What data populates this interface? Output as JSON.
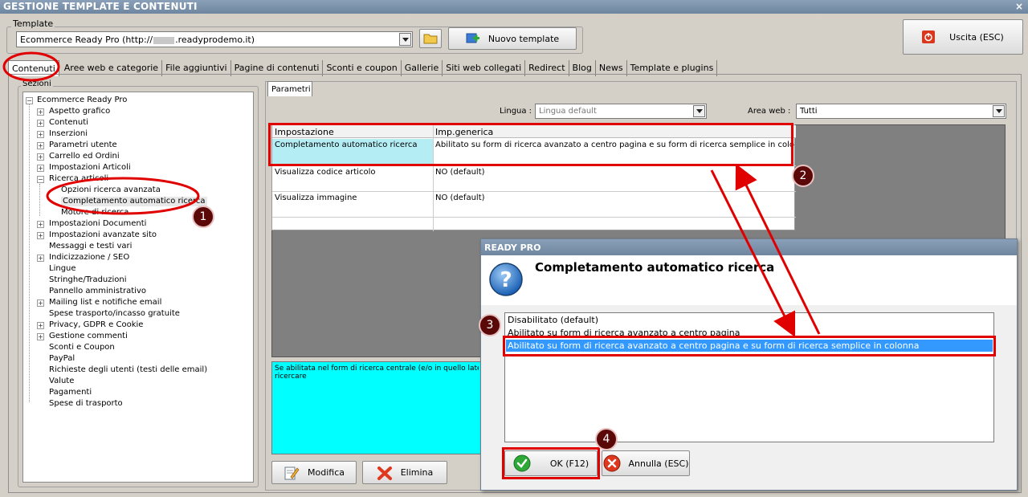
{
  "window": {
    "title": "GESTIONE TEMPLATE E CONTENUTI",
    "close_glyph": "×"
  },
  "template": {
    "group_label": "Template",
    "selected": "Ecommerce Ready Pro (http://",
    "selected_suffix": ".readyprodemo.it)",
    "new_template_label": "Nuovo template"
  },
  "exit_button": {
    "label": "Uscita (ESC)"
  },
  "tabs": [
    {
      "label": "Contenuti",
      "active": true
    },
    {
      "label": "Aree web e categorie"
    },
    {
      "label": "File aggiuntivi"
    },
    {
      "label": "Pagine di contenuti"
    },
    {
      "label": "Sconti e coupon"
    },
    {
      "label": "Gallerie"
    },
    {
      "label": "Siti web collegati"
    },
    {
      "label": "Redirect"
    },
    {
      "label": "Blog"
    },
    {
      "label": "News"
    },
    {
      "label": "Template e plugins"
    }
  ],
  "sections": {
    "label": "Sezioni",
    "root": "Ecommerce Ready Pro",
    "items": [
      "Aspetto grafico",
      "Contenuti",
      "Inserzioni",
      "Parametri utente",
      "Carrello ed Ordini",
      "Impostazioni Articoli",
      "Ricerca articoli",
      "Opzioni ricerca avanzata",
      "Completamento automatico ricerca",
      "Motore di ricerca",
      "Impostazioni Documenti",
      "Impostazioni avanzate sito",
      "Messaggi e testi vari",
      "Indicizzazione / SEO",
      "Lingue",
      "Stringhe/Traduzioni",
      "Pannello amministrativo",
      "Mailing list e notifiche email",
      "Spese trasporto/incasso gratuite",
      "Privacy, GDPR e Cookie",
      "Gestione commenti",
      "Sconti e Coupon",
      "PayPal",
      "Richieste degli utenti (testi delle email)",
      "Valute",
      "Pagamenti",
      "Spese di trasporto"
    ]
  },
  "params": {
    "tab_label": "Parametri",
    "lingua_label": "Lingua :",
    "lingua_value": "Lingua default",
    "area_label": "Area web :",
    "area_value": "Tutti",
    "columns": [
      "Impostazione",
      "Imp.generica"
    ],
    "rows": [
      {
        "name": "Completamento automatico ricerca",
        "value": "Abilitato su form di ricerca avanzato a centro pagina e su form di ricerca semplice in colonna"
      },
      {
        "name": "Visualizza codice articolo",
        "value": "NO (default)"
      },
      {
        "name": "Visualizza immagine",
        "value": "NO (default)"
      }
    ],
    "description": "Se abilitata nel form di ricerca centrale (e/o in quello latera",
    "description_line2": "ricercare",
    "modify_label": "Modifica",
    "delete_label": "Elimina"
  },
  "dialog": {
    "title": "READY PRO",
    "heading": "Completamento automatico ricerca",
    "options": [
      "Disabilitato (default)",
      "Abilitato su form di ricerca avanzato a centro pagina",
      "Abilitato su form di ricerca avanzato a centro pagina e su form di ricerca semplice in colonna"
    ],
    "selected_index": 2,
    "ok_label": "OK (F12)",
    "cancel_label": "Annulla (ESC)"
  },
  "annotations": {
    "badges": [
      "1",
      "2",
      "3",
      "4"
    ],
    "color": "#e00000"
  }
}
